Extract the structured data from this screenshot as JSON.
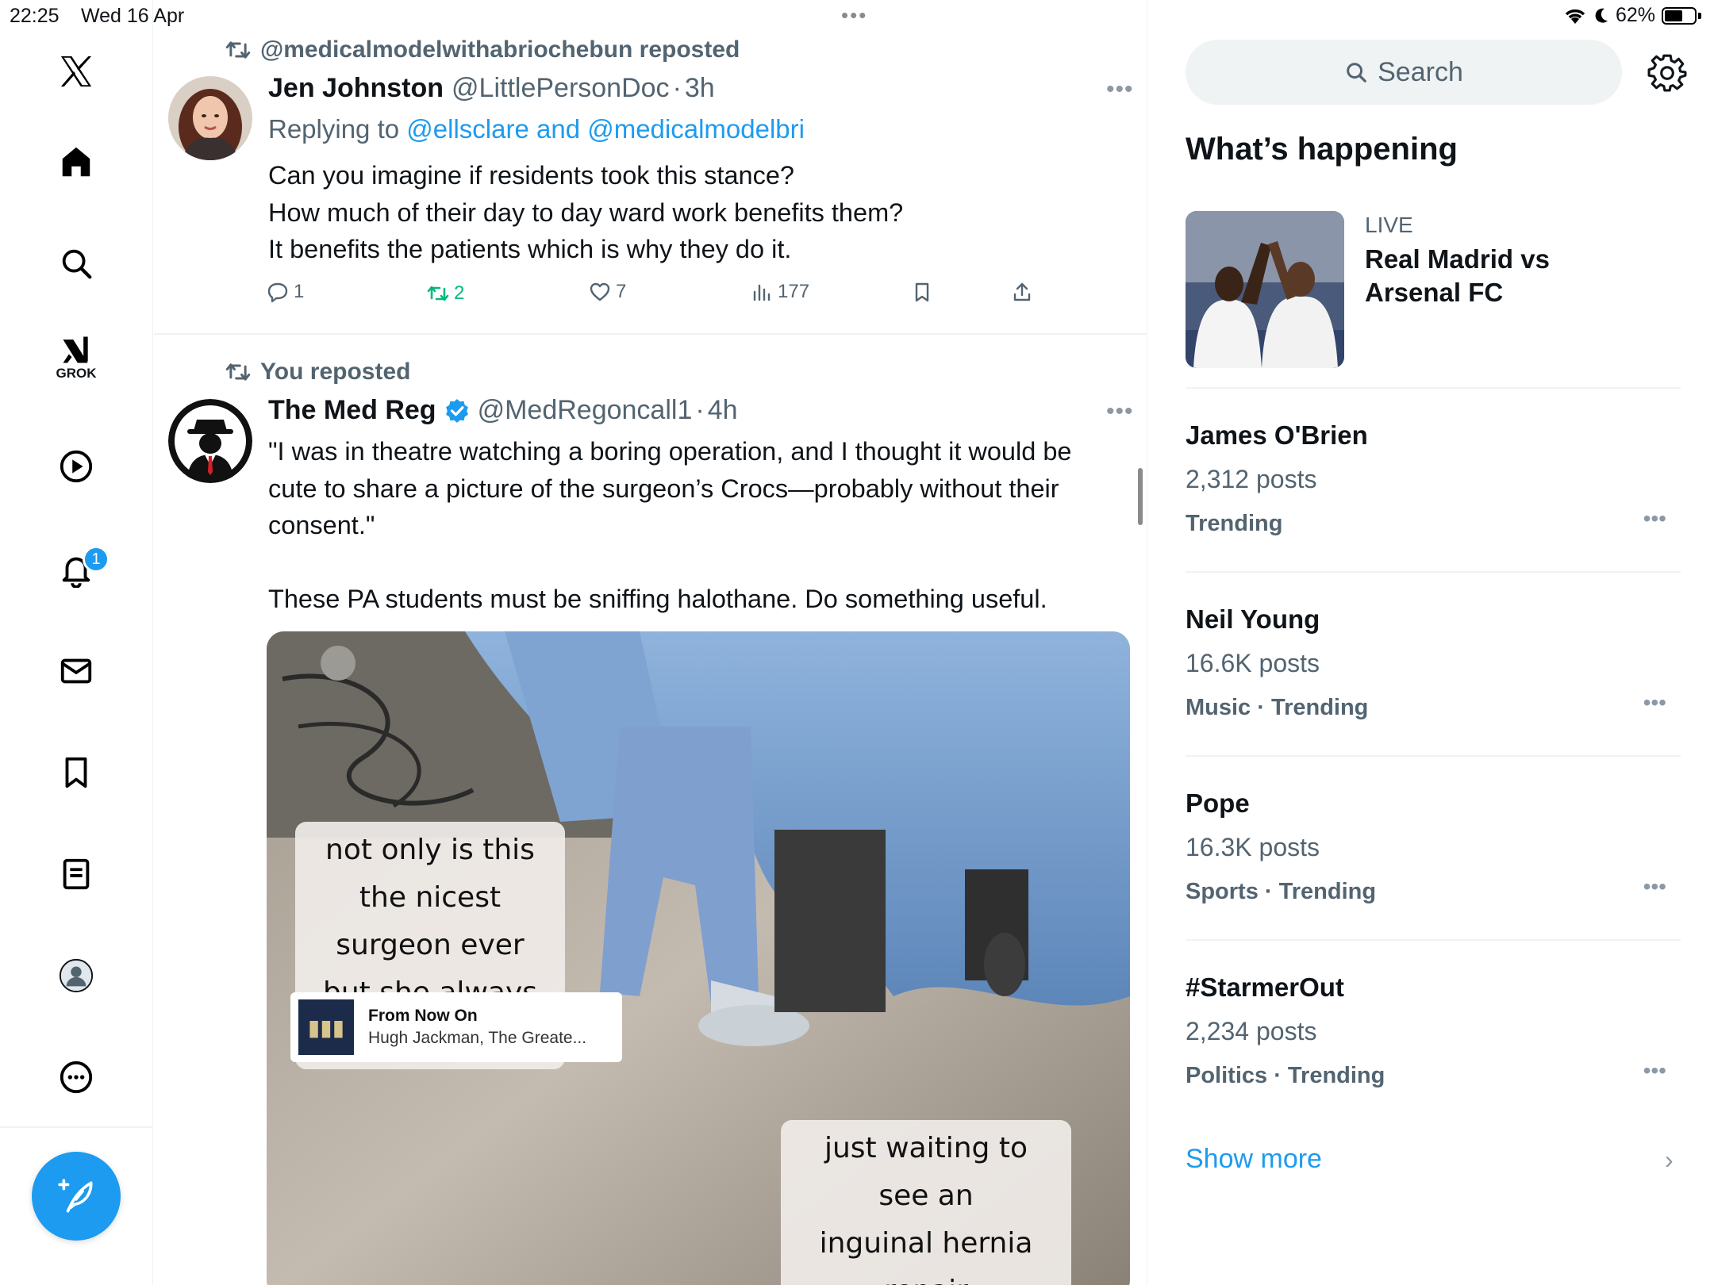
{
  "status_bar": {
    "time": "22:25",
    "date": "Wed 16 Apr",
    "battery": "62%",
    "battery_level": 0.62
  },
  "nav": {
    "grok_label": "GROK",
    "notifications_badge": "1"
  },
  "feed": {
    "posts": [
      {
        "repost_by": "@medicalmodelwithabriochebun reposted",
        "author": "Jen Johnston",
        "handle": "@LittlePersonDoc",
        "sep": "·",
        "time": "3h",
        "replying_prefix": "Replying to",
        "replying_to": "@ellsclare and @medicalmodelbri",
        "text": "Can you imagine if residents took this stance?\nHow much of their day to day ward work benefits them?\nIt benefits the patients which is why they do it.",
        "actions": {
          "replies": "1",
          "reposts": "2",
          "likes": "7",
          "views": "177"
        }
      },
      {
        "repost_by": "You reposted",
        "author": "The Med Reg",
        "verified": true,
        "handle": "@MedRegoncall1",
        "sep": "·",
        "time": "4h",
        "text": "\"I was in theatre watching a boring operation, and I thought it would be cute to share a picture of the surgeon’s Crocs—probably without their consent.\"\n\nThese PA students must be sniffing halothane. Do something useful.",
        "media": {
          "caption_top": "not only is this the nicest\nsurgeon ever but she always\nplays bops 🔥😅",
          "music_title": "From Now On",
          "music_artist": "Hugh Jackman, The Greate...",
          "caption_bottom": "just waiting to see an\ninguinal hernia repair"
        }
      }
    ]
  },
  "sidebar": {
    "search_placeholder": "Search",
    "section_title": "What’s happening",
    "live": {
      "label": "LIVE",
      "title": "Real Madrid vs Arsenal FC"
    },
    "trends": [
      {
        "title": "James O'Brien",
        "count": "2,312 posts",
        "context": "Trending"
      },
      {
        "title": "Neil Young",
        "count": "16.6K posts",
        "context": "Music · Trending"
      },
      {
        "title": "Pope",
        "count": "16.3K posts",
        "context": "Sports · Trending"
      },
      {
        "title": "#StarmerOut",
        "count": "2,234 posts",
        "context": "Politics · Trending"
      }
    ],
    "show_more": "Show more"
  },
  "colors": {
    "accent": "#1d9bf0",
    "repost_green": "#00ba7c",
    "secondary_text": "#536471"
  }
}
